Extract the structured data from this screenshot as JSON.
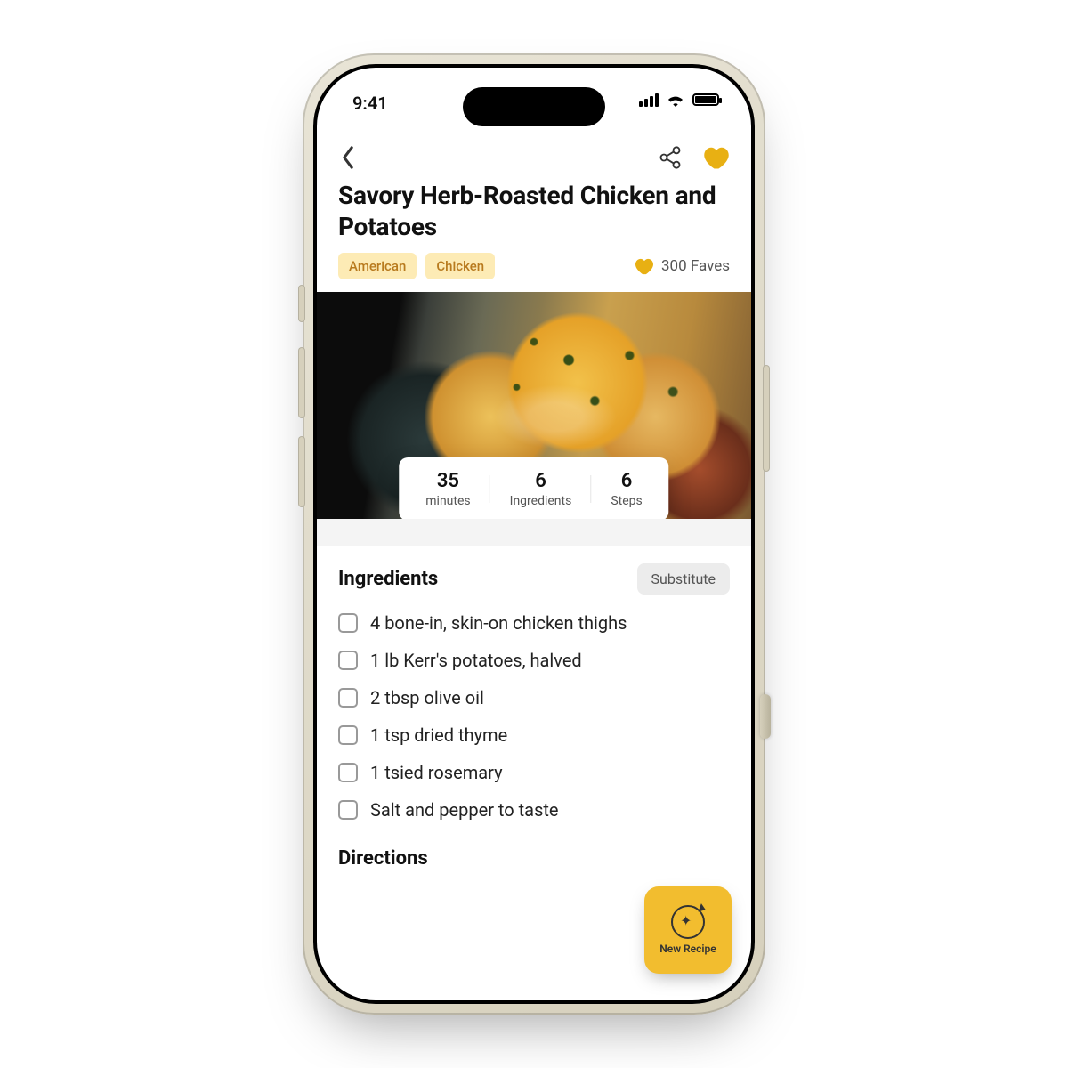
{
  "status": {
    "time": "9:41"
  },
  "header": {
    "title": "Savory Herb-Roasted Chicken and Potatoes",
    "tags": [
      "American",
      "Chicken"
    ],
    "faves_label": "300 Faves"
  },
  "stats": {
    "minutes": {
      "value": "35",
      "label": "minutes"
    },
    "ingredients": {
      "value": "6",
      "label": "Ingredients"
    },
    "steps": {
      "value": "6",
      "label": "Steps"
    }
  },
  "sections": {
    "ingredients_title": "Ingredients",
    "substitute_label": "Substitute",
    "directions_title": "Directions"
  },
  "ingredients": [
    "4 bone-in, skin-on chicken thighs",
    "1 lb Kerr's potatoes, halved",
    "2 tbsp olive oil",
    "1 tsp dried thyme",
    "1 tsied rosemary",
    "Salt and pepper to taste"
  ],
  "fab": {
    "label": "New Recipe"
  },
  "colors": {
    "accent": "#f2bd2f",
    "tag_bg": "#fdebb5",
    "tag_fg": "#b87a1e"
  }
}
